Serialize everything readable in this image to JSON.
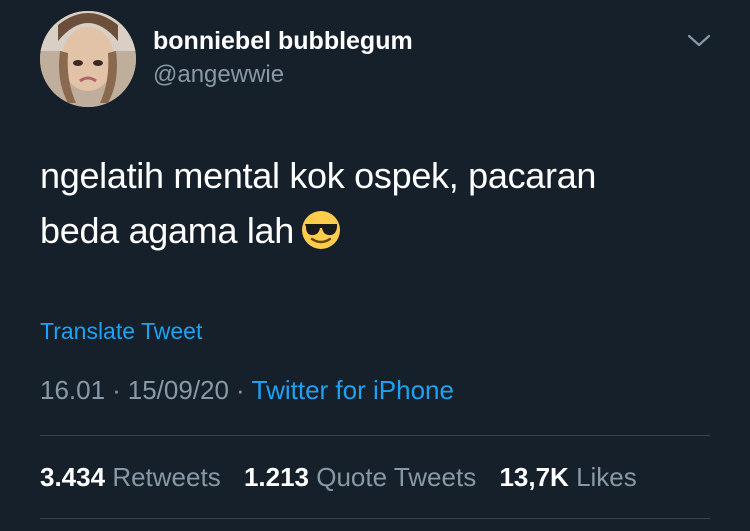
{
  "user": {
    "display_name": "bonniebel bubblegum",
    "handle": "@angewwie",
    "avatar": "avatar"
  },
  "header": {
    "menu_icon": "chevron-down-icon"
  },
  "tweet": {
    "text_lines": [
      "ngelatih mental kok ospek, pacaran",
      "beda agama lah"
    ],
    "emoji": "smiling-face-with-sunglasses",
    "translate_label": "Translate Tweet"
  },
  "meta": {
    "time": "16.01",
    "separator": "·",
    "date": "15/09/20",
    "source": "Twitter for iPhone"
  },
  "stats": {
    "retweets_count": "3.434",
    "retweets_label": "Retweets",
    "quotes_count": "1.213",
    "quotes_label": "Quote Tweets",
    "likes_count": "13,7K",
    "likes_label": "Likes"
  },
  "colors": {
    "background": "#15202b",
    "primary_text": "#ffffff",
    "secondary_text": "#8899a6",
    "accent": "#1da1f2",
    "divider": "#38444d"
  }
}
